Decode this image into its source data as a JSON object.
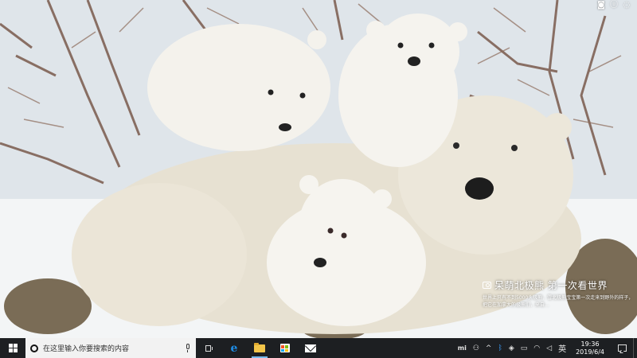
{
  "desktop": {
    "spotlight": {
      "title": "呆萌北极熊 第一次看世界",
      "description": "世界上只有不到5000头极熊，雪北极熊宝宝第一次走来到野外的样子，把它在加拿大的极熊们，来自…"
    },
    "top_icons": [
      "camera-icon",
      "info-icon",
      "settings-icon"
    ]
  },
  "taskbar": {
    "search_placeholder": "在这里输入你要搜索的内容",
    "apps": [
      {
        "name": "task-view",
        "icon": "task-view-icon"
      },
      {
        "name": "edge",
        "icon": "edge-icon"
      },
      {
        "name": "file-explorer",
        "icon": "folder-icon"
      },
      {
        "name": "store",
        "icon": "store-icon"
      },
      {
        "name": "mail",
        "icon": "mail-icon"
      }
    ],
    "tray": {
      "mi_label": "mi",
      "up_arrow": "^",
      "ime_label": "英",
      "time": "19:36",
      "date": "2019/6/4"
    }
  }
}
